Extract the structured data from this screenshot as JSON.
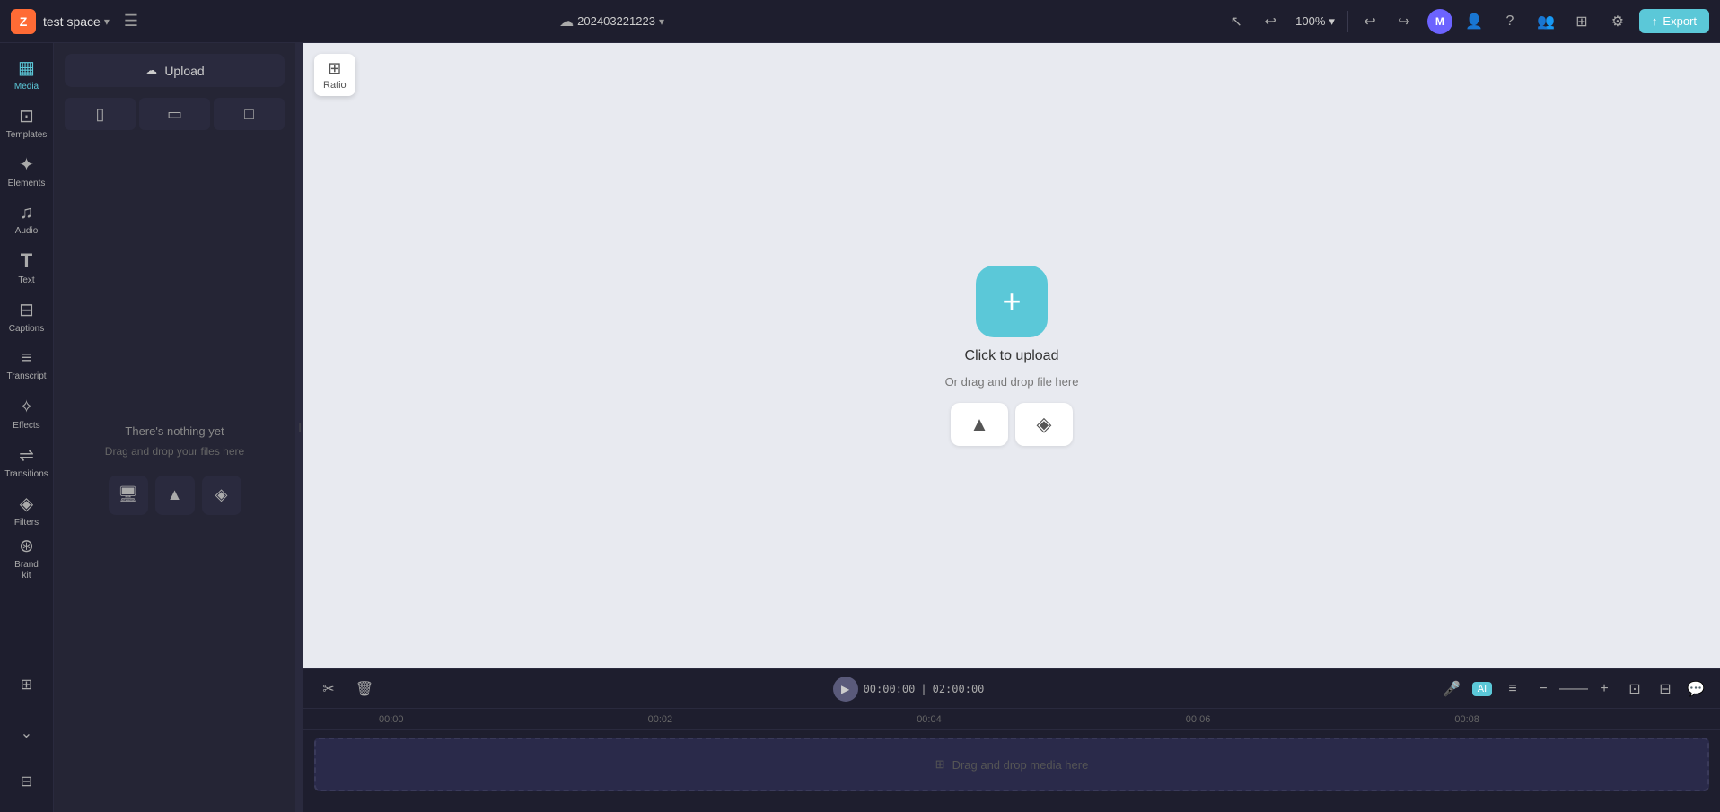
{
  "app": {
    "brand_icon": "Z",
    "workspace_name": "test space",
    "project_id": "202403221223",
    "export_label": "Export"
  },
  "topbar": {
    "zoom_level": "100%",
    "undo_icon": "↩",
    "redo_icon": "↪",
    "help_icon": "?",
    "people_icon": "👤",
    "settings_icon": "⚙",
    "layout_icon": "⊞"
  },
  "sidebar": {
    "items": [
      {
        "id": "media",
        "label": "Media",
        "icon": "▦",
        "active": true
      },
      {
        "id": "templates",
        "label": "Templates",
        "icon": "⊡"
      },
      {
        "id": "elements",
        "label": "Elements",
        "icon": "✦"
      },
      {
        "id": "audio",
        "label": "Audio",
        "icon": "♫"
      },
      {
        "id": "text",
        "label": "Text",
        "icon": "T"
      },
      {
        "id": "captions",
        "label": "Captions",
        "icon": "⊟"
      },
      {
        "id": "transcript",
        "label": "Transcript",
        "icon": "≡"
      },
      {
        "id": "effects",
        "label": "Effects",
        "icon": "✧"
      },
      {
        "id": "transitions",
        "label": "Transitions",
        "icon": "⇌"
      },
      {
        "id": "filters",
        "label": "Filters",
        "icon": "◈"
      },
      {
        "id": "brand",
        "label": "Brand kit",
        "icon": "⊛"
      }
    ],
    "bottom_items": [
      {
        "id": "apps",
        "label": "Apps",
        "icon": "⊞"
      },
      {
        "id": "more",
        "label": "More",
        "icon": "⌄"
      },
      {
        "id": "captions2",
        "label": "",
        "icon": "⊟"
      }
    ]
  },
  "media_panel": {
    "upload_label": "Upload",
    "format_tabs": [
      {
        "id": "portrait",
        "icon": "▯"
      },
      {
        "id": "landscape",
        "icon": "▭"
      },
      {
        "id": "square",
        "icon": "□"
      }
    ],
    "empty_title": "There's nothing yet",
    "empty_subtitle": "Drag and drop your files here",
    "action_btns": [
      {
        "id": "screen",
        "icon": "🖥"
      },
      {
        "id": "drive",
        "icon": "▲"
      },
      {
        "id": "dropbox",
        "icon": "◈"
      }
    ]
  },
  "canvas": {
    "ratio_label": "Ratio",
    "upload_circle_icon": "+",
    "upload_title": "Click to upload",
    "upload_subtitle": "Or drag and drop file here",
    "upload_options": [
      {
        "id": "drive",
        "icon": "▲"
      },
      {
        "id": "dropbox",
        "icon": "◈"
      }
    ]
  },
  "timeline": {
    "time_current": "00:00:00",
    "time_total": "02:00:00",
    "ruler_marks": [
      "00:00",
      "00:02",
      "00:04",
      "00:06",
      "00:08"
    ],
    "track_empty_text": "Drag and drop media here",
    "toolbar_icons": {
      "cut": "✂",
      "delete": "🗑"
    }
  }
}
